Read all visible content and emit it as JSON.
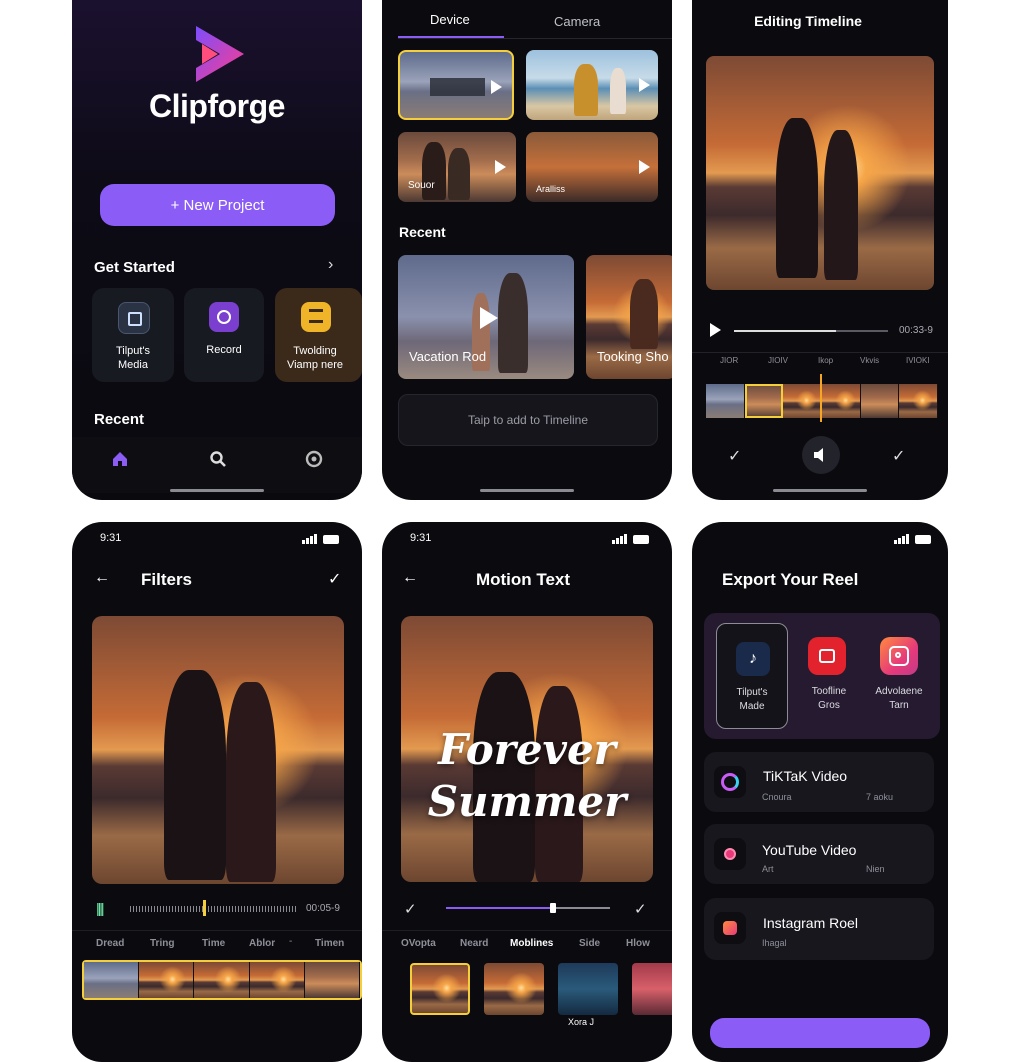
{
  "screen1": {
    "app_name": "Clipforge",
    "new_project_label": "+ New Project",
    "get_started_label": "Get Started",
    "recent_label": "Recent",
    "tiles": [
      {
        "label_line1": "Tilput's",
        "label_line2": "Media"
      },
      {
        "label_line1": "Record",
        "label_line2": ""
      },
      {
        "label_line1": "Twolding",
        "label_line2": "Viamp nere"
      }
    ],
    "colors": {
      "accent": "#8b5cf6"
    }
  },
  "screen2": {
    "tabs": [
      "Device",
      "Camera"
    ],
    "grid_labels": [
      "Souor",
      "Aralliss"
    ],
    "recent_label": "Recent",
    "recent_items": [
      "Vacation Rod",
      "Tooking Sho"
    ],
    "add_hint": "Taip to add to Timeline"
  },
  "screen3": {
    "title": "Editing Timeline",
    "time": "00:33-9",
    "ruler": [
      "JIOR",
      "JIOIV",
      "Ikop",
      "Vkvis",
      "IVIOKI"
    ]
  },
  "screen4": {
    "status_time": "9:31",
    "title": "Filters",
    "time": "00:05-9",
    "filter_tabs": [
      "Dread",
      "Tring",
      "Time",
      "Ablor",
      "-",
      "Timen"
    ]
  },
  "screen5": {
    "status_time": "9:31",
    "title": "Motion Text",
    "overlay_line1": "Forever",
    "overlay_line2": "Summer",
    "style_tabs": [
      "OVopta",
      "Neard",
      "Moblines",
      "Side",
      "Hlow"
    ],
    "thumb_caption": "Xora J"
  },
  "screen6": {
    "title": "Export Your Reel",
    "targets": [
      {
        "line1": "Tilput's",
        "line2": "Made"
      },
      {
        "line1": "Toofline",
        "line2": "Gros"
      },
      {
        "line1": "Advolaene",
        "line2": "Tarn"
      }
    ],
    "rows": [
      {
        "title": "TiKTaK Video",
        "sub_left": "Cnoura",
        "sub_right": "7 aoku"
      },
      {
        "title": "YouTube Video",
        "sub_left": "Art",
        "sub_right": "Nien"
      },
      {
        "title": "Instagram Roel",
        "sub_left": "Ihagal",
        "sub_right": ""
      }
    ]
  }
}
